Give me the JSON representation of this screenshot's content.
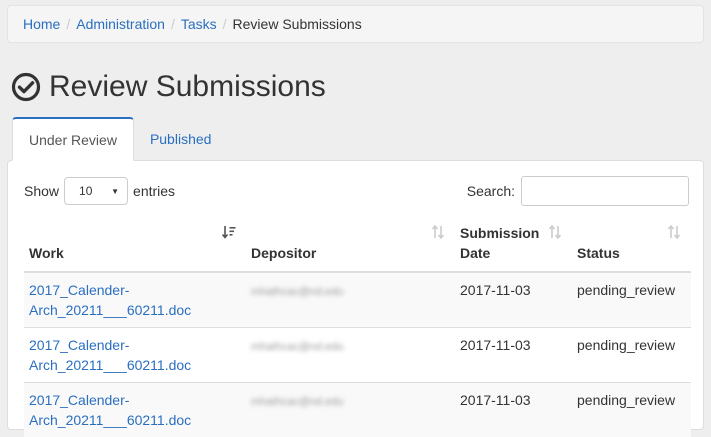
{
  "breadcrumb": {
    "items": [
      {
        "label": "Home"
      },
      {
        "label": "Administration"
      },
      {
        "label": "Tasks"
      }
    ],
    "current": "Review Submissions",
    "separator": "/"
  },
  "page": {
    "title": "Review Submissions",
    "title_icon": "check-circle-icon"
  },
  "tabs": [
    {
      "label": "Under Review",
      "active": true
    },
    {
      "label": "Published",
      "active": false
    }
  ],
  "table_controls": {
    "show_label": "Show",
    "page_size": "10",
    "entries_label": "entries",
    "search_label": "Search:",
    "search_value": ""
  },
  "table": {
    "columns": [
      {
        "label": "Work",
        "sort": "sorted-desc"
      },
      {
        "label": "Depositor",
        "sort": "sortable"
      },
      {
        "label": "Submission Date",
        "sort": "sortable"
      },
      {
        "label": "Status",
        "sort": "sortable"
      }
    ],
    "rows": [
      {
        "work_line1": "2017_Calender-",
        "work_line2": "Arch_20211___60211.doc",
        "depositor": "mhathcac@nd.edu",
        "date": "2017-11-03",
        "status": "pending_review"
      },
      {
        "work_line1": "2017_Calender-",
        "work_line2": "Arch_20211___60211.doc",
        "depositor": "mhathcac@nd.edu",
        "date": "2017-11-03",
        "status": "pending_review"
      },
      {
        "work_line1": "2017_Calender-",
        "work_line2": "Arch_20211___60211.doc",
        "depositor": "mhathcac@nd.edu",
        "date": "2017-11-03",
        "status": "pending_review"
      }
    ]
  },
  "colors": {
    "link": "#2a6fc0",
    "background": "#eeeeee",
    "stripe": "#f9f9f9"
  }
}
